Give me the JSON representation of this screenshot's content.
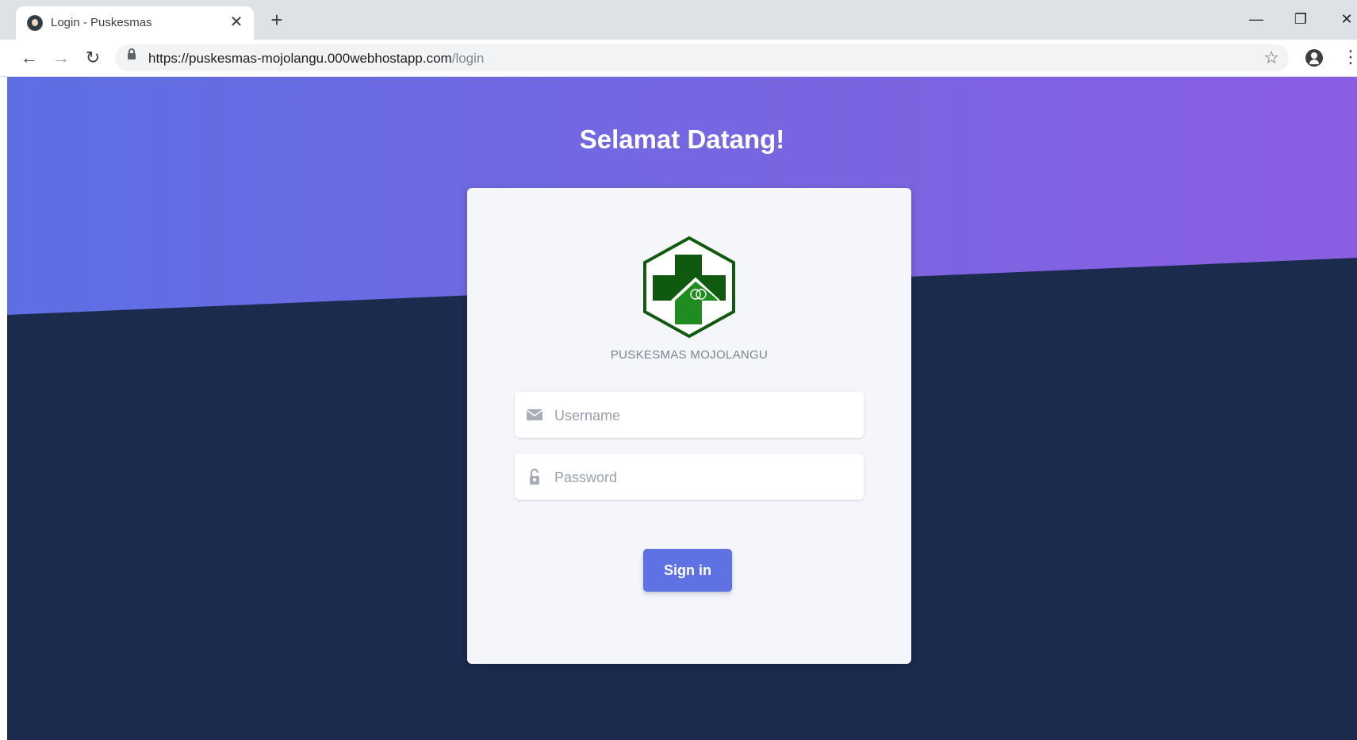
{
  "browser": {
    "tab_title": "Login - Puskesmas",
    "tab_close": "✕",
    "new_tab": "+",
    "url_base": "https://puskesmas-mojolangu.000webhostapp.com",
    "url_path": "/login",
    "window_controls": {
      "minimize": "—",
      "restore": "❐",
      "close": "✕"
    },
    "nav": {
      "back": "←",
      "forward": "→",
      "reload": "↻"
    },
    "star": "☆",
    "menu": "⋮"
  },
  "page": {
    "title": "Selamat Datang!",
    "brand": "PUSKESMAS MOJOLANGU",
    "colors": {
      "gradient_start": "#5e6fe4",
      "gradient_end": "#8a5ee2",
      "background": "#1a2b4e",
      "card": "#f4f6fa",
      "button": "#5e72e4",
      "logo_green": "#1a7a1a"
    },
    "form": {
      "username": {
        "placeholder": "Username",
        "value": "",
        "icon": "envelope-icon"
      },
      "password": {
        "placeholder": "Password",
        "value": "",
        "icon": "unlock-icon"
      },
      "submit_label": "Sign in"
    }
  }
}
